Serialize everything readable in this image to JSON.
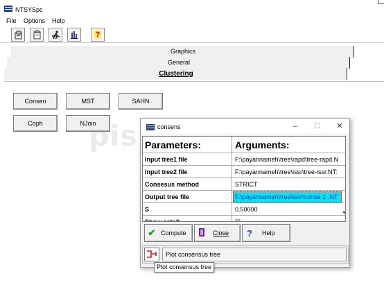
{
  "app": {
    "title": "NTSYSpc",
    "icon": "ntsys-app-icon"
  },
  "menu": [
    "File",
    "Options",
    "Help"
  ],
  "toolbar": {
    "icons": [
      "open-file-icon",
      "clipboard-icon",
      "run-icon",
      "chart-icon",
      "help-question-icon"
    ]
  },
  "tabs": {
    "graphics": "Graphics",
    "general": "General",
    "clustering": "Clustering"
  },
  "module_buttons": {
    "consen": "Consen",
    "mst": "MST",
    "sahn": "SAHN",
    "coph": "Coph",
    "njoin": "NJoin"
  },
  "watermark": "pishgam bio.ir",
  "dialog": {
    "title": "consens",
    "controls": {
      "minimize": "–",
      "maximize": "☐",
      "close": "✕"
    },
    "header": {
      "parameters": "Parameters:",
      "arguments": "Arguments:"
    },
    "rows": [
      {
        "param": "Input tree1 file",
        "value": "F:\\payannameh\\tree\\rapd\\tree-rapd.N"
      },
      {
        "param": "Input tree2 file",
        "value": "F:\\payannameh\\tree\\issr\\tree-issr.NT:"
      },
      {
        "param": "Consesus method",
        "value": "STRICT"
      },
      {
        "param": "Output tree file",
        "value": "F:\\payannameh\\tree\\issr\\conse 2 .NT"
      },
      {
        "param": "S",
        "value": "0.50000"
      },
      {
        "param": "Show sets?",
        "value": "☒"
      }
    ],
    "buttons": {
      "compute": "Compute",
      "close": "Close",
      "help": "Help"
    },
    "plot": {
      "label": "Plot consensus tree",
      "tooltip": "Plot consensus tree"
    }
  }
}
